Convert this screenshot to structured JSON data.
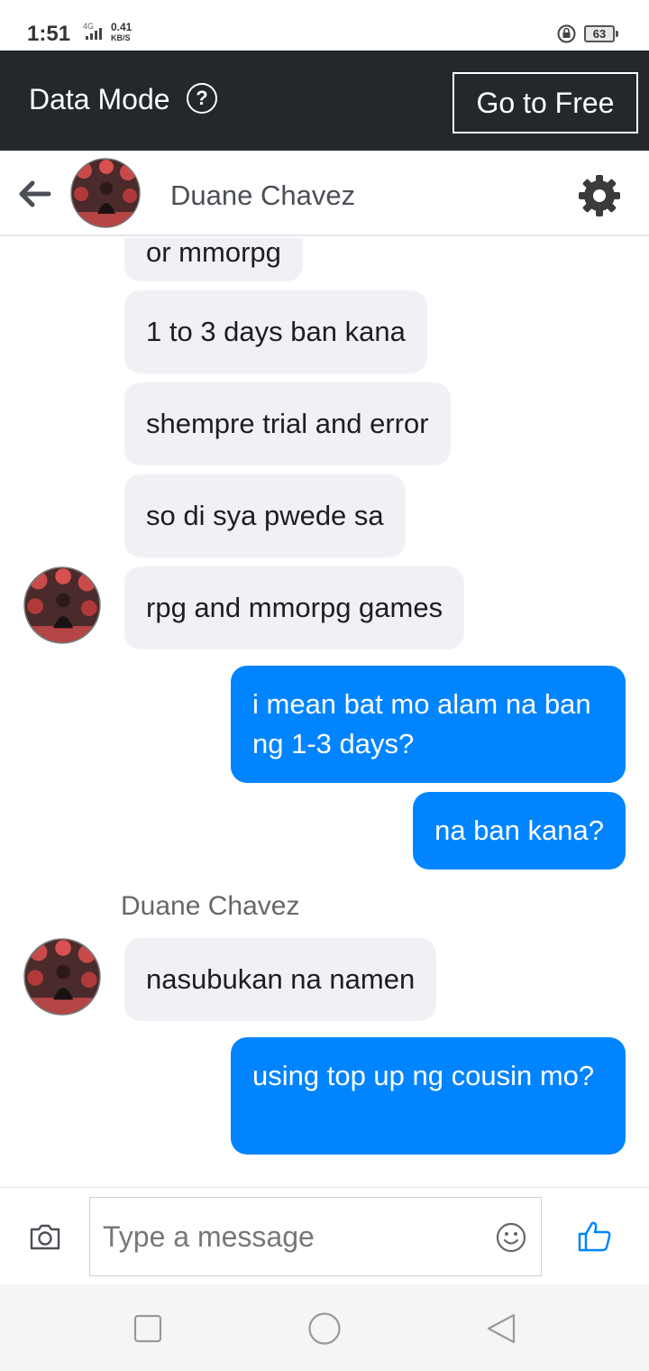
{
  "status_bar": {
    "time": "1:51",
    "network": "4G",
    "speed_value": "0.41",
    "speed_unit": "KB/S",
    "battery": "63"
  },
  "data_mode": {
    "title": "Data Mode",
    "help_icon": "?",
    "go_free_label": "Go to Free"
  },
  "header": {
    "contact_name": "Duane Chavez"
  },
  "messages": [
    {
      "direction": "in",
      "text": "or mmorpg"
    },
    {
      "direction": "in",
      "text": "1 to 3 days ban kana"
    },
    {
      "direction": "in",
      "text": "shempre trial and error"
    },
    {
      "direction": "in",
      "text": "so di sya pwede sa"
    },
    {
      "direction": "in",
      "text": "rpg and mmorpg games"
    },
    {
      "direction": "out",
      "text": "i mean bat mo alam na ban ng 1-3 days?"
    },
    {
      "direction": "out",
      "text": "na ban kana?"
    },
    {
      "direction": "in",
      "text": "nasubukan na namen"
    },
    {
      "direction": "out",
      "text": "using top up ng cousin mo?"
    }
  ],
  "sender_label": "Duane Chavez",
  "composer": {
    "placeholder": "Type a message",
    "value": ""
  },
  "colors": {
    "outgoing": "#0084ff",
    "incoming": "#f0f1f5",
    "data_bar": "#24272b"
  },
  "icons": [
    "back-arrow-icon",
    "gear-icon",
    "camera-icon",
    "emoji-icon",
    "like-icon",
    "recent-apps-icon",
    "home-icon",
    "back-icon"
  ]
}
